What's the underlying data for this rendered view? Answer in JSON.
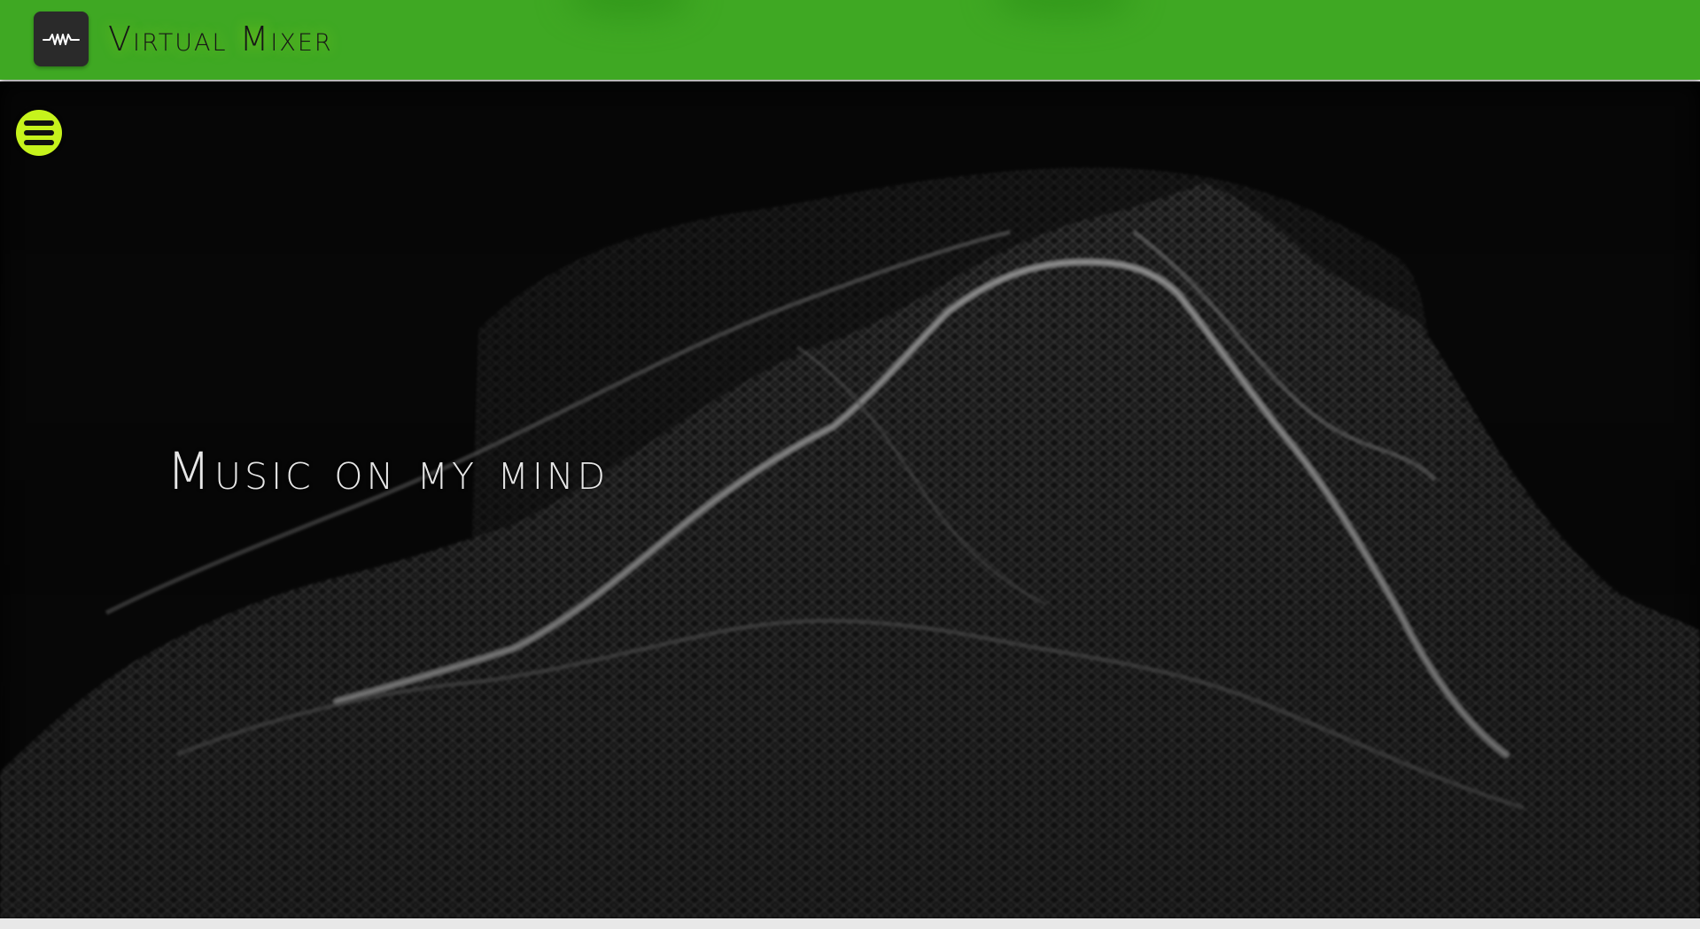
{
  "header": {
    "brand_title": "Virtual Mixer",
    "logo_icon": "waveform-icon",
    "background_color": "#3fa823"
  },
  "stage": {
    "background_color": "#070707",
    "visual": "3d-wireframe-terrain",
    "menu_button_color": "#c6f31c",
    "menu_icon": "hamburger-menu-icon"
  },
  "hero": {
    "title": "Music on my mind"
  }
}
